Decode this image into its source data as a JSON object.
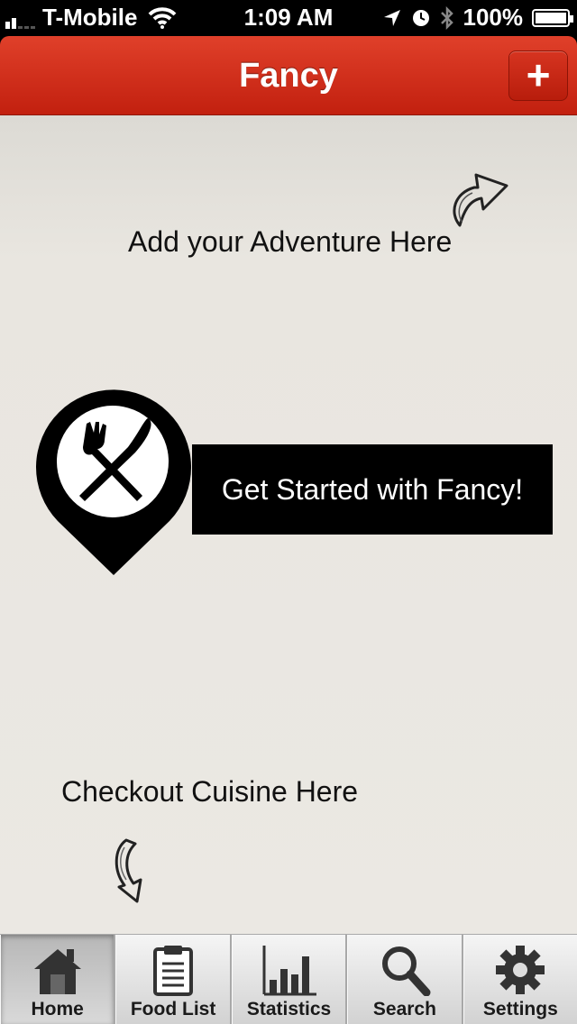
{
  "status_bar": {
    "carrier": "T-Mobile",
    "time": "1:09 AM",
    "battery": "100%"
  },
  "nav": {
    "title": "Fancy",
    "add_label": "+"
  },
  "main": {
    "add_hint": "Add your Adventure Here",
    "cta_label": "Get Started with Fancy!",
    "cuisine_hint": "Checkout Cuisine Here"
  },
  "tabs": [
    {
      "label": "Home",
      "icon": "home-icon",
      "active": true
    },
    {
      "label": "Food List",
      "icon": "clipboard-icon",
      "active": false
    },
    {
      "label": "Statistics",
      "icon": "bar-chart-icon",
      "active": false
    },
    {
      "label": "Search",
      "icon": "search-icon",
      "active": false
    },
    {
      "label": "Settings",
      "icon": "gear-icon",
      "active": false
    }
  ],
  "colors": {
    "nav_red": "#d02c17",
    "background": "#ebe8e3",
    "cta_bg": "#000000"
  }
}
